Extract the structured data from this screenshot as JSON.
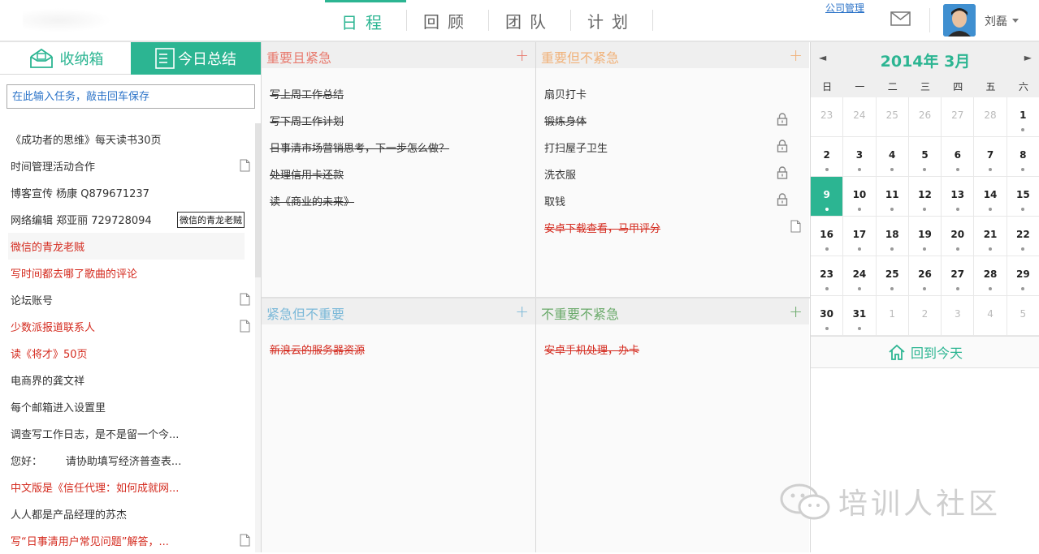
{
  "header": {
    "nav_tabs": [
      {
        "label": "日程",
        "active": true
      },
      {
        "label": "回顾",
        "active": false
      },
      {
        "label": "团队",
        "active": false
      },
      {
        "label": "计划",
        "active": false
      }
    ],
    "company_link": "公司管理",
    "mail_icon": "mail-icon",
    "username": "刘磊"
  },
  "sidebar": {
    "tabs": [
      {
        "label": "收纳箱",
        "icon": "inbox-icon"
      },
      {
        "label": "今日总结",
        "icon": "summary-list-icon"
      }
    ],
    "input_placeholder": "在此输入任务，敲击回车保存",
    "items": [
      {
        "text": "《成功者的思维》每天读书30页",
        "red": false,
        "doc": false
      },
      {
        "text": "时间管理活动合作",
        "red": false,
        "doc": true
      },
      {
        "text": "博客宣传 杨康 Q879671237",
        "red": false,
        "doc": false
      },
      {
        "text": "网络编辑 郑亚丽 729728094",
        "red": false,
        "doc": false
      },
      {
        "text": "微信的青龙老贼",
        "red": true,
        "doc": false
      },
      {
        "text": "写时间都去哪了歌曲的评论",
        "red": true,
        "doc": false
      },
      {
        "text": "论坛账号",
        "red": false,
        "doc": true
      },
      {
        "text": "少数派报道联系人",
        "red": true,
        "doc": true
      },
      {
        "text": "读《将才》50页",
        "red": true,
        "doc": false
      },
      {
        "text": "电商界的龚文祥",
        "red": false,
        "doc": false
      },
      {
        "text": "每个邮箱进入设置里",
        "red": false,
        "doc": false
      },
      {
        "text": "调查写工作日志，是不是留一个今...",
        "red": false,
        "doc": false
      },
      {
        "text": "您好：       请协助填写经济普查表...",
        "red": false,
        "doc": false
      },
      {
        "text": "中文版是《信任代理：如何成就网...",
        "red": true,
        "doc": false
      },
      {
        "text": "人人都是产品经理的苏杰",
        "red": false,
        "doc": false
      },
      {
        "text": "写“日事清用户常见问题”解答，...",
        "red": true,
        "doc": true
      }
    ],
    "tooltip": "微信的青龙老贼"
  },
  "quadrants": {
    "q1": {
      "title": "重要且紧急",
      "color": "#e87a6e",
      "items": [
        {
          "text": "写上周工作总结"
        },
        {
          "text": "写下周工作计划"
        },
        {
          "text": "日事清市场营销思考，下一步怎么做？"
        },
        {
          "text": "处理信用卡还款"
        },
        {
          "text": "读《商业的未来》"
        }
      ]
    },
    "q2": {
      "title": "重要但不紧急",
      "color": "#f0b27a",
      "items": [
        {
          "text": "扇贝打卡",
          "lock": false
        },
        {
          "text": "锻炼身体",
          "lock": true
        },
        {
          "text": "打扫屋子卫生",
          "lock": true
        },
        {
          "text": "洗衣服",
          "lock": true
        },
        {
          "text": "取钱",
          "lock": true
        },
        {
          "text": "安卓下载查看，马甲评分",
          "red": true,
          "doc": true
        }
      ]
    },
    "q3": {
      "title": "紧急但不重要",
      "color": "#7ab8d8",
      "items": [
        {
          "text": "新浪云的服务器资源"
        }
      ]
    },
    "q4": {
      "title": "不重要不紧急",
      "color": "#6aaa6a",
      "items": [
        {
          "text": "安卓手机处理，办卡"
        }
      ]
    }
  },
  "calendar": {
    "title": "2014年 3月",
    "prev": "◄",
    "next": "►",
    "weekdays": [
      "日",
      "一",
      "二",
      "三",
      "四",
      "五",
      "六"
    ],
    "days": [
      "23",
      "24",
      "25",
      "26",
      "27",
      "28",
      "1",
      "2",
      "3",
      "4",
      "5",
      "6",
      "7",
      "8",
      "9",
      "10",
      "11",
      "12",
      "13",
      "14",
      "15",
      "16",
      "17",
      "18",
      "19",
      "20",
      "21",
      "22",
      "23",
      "24",
      "25",
      "26",
      "27",
      "28",
      "29",
      "30",
      "31",
      "1",
      "2",
      "3",
      "4",
      "5"
    ],
    "today_index": 14,
    "today_button": "回到今天"
  },
  "watermark": "培训人社区",
  "colors": {
    "accent": "#2cb592",
    "red": "#d42a1e",
    "link": "#2b73c8"
  }
}
